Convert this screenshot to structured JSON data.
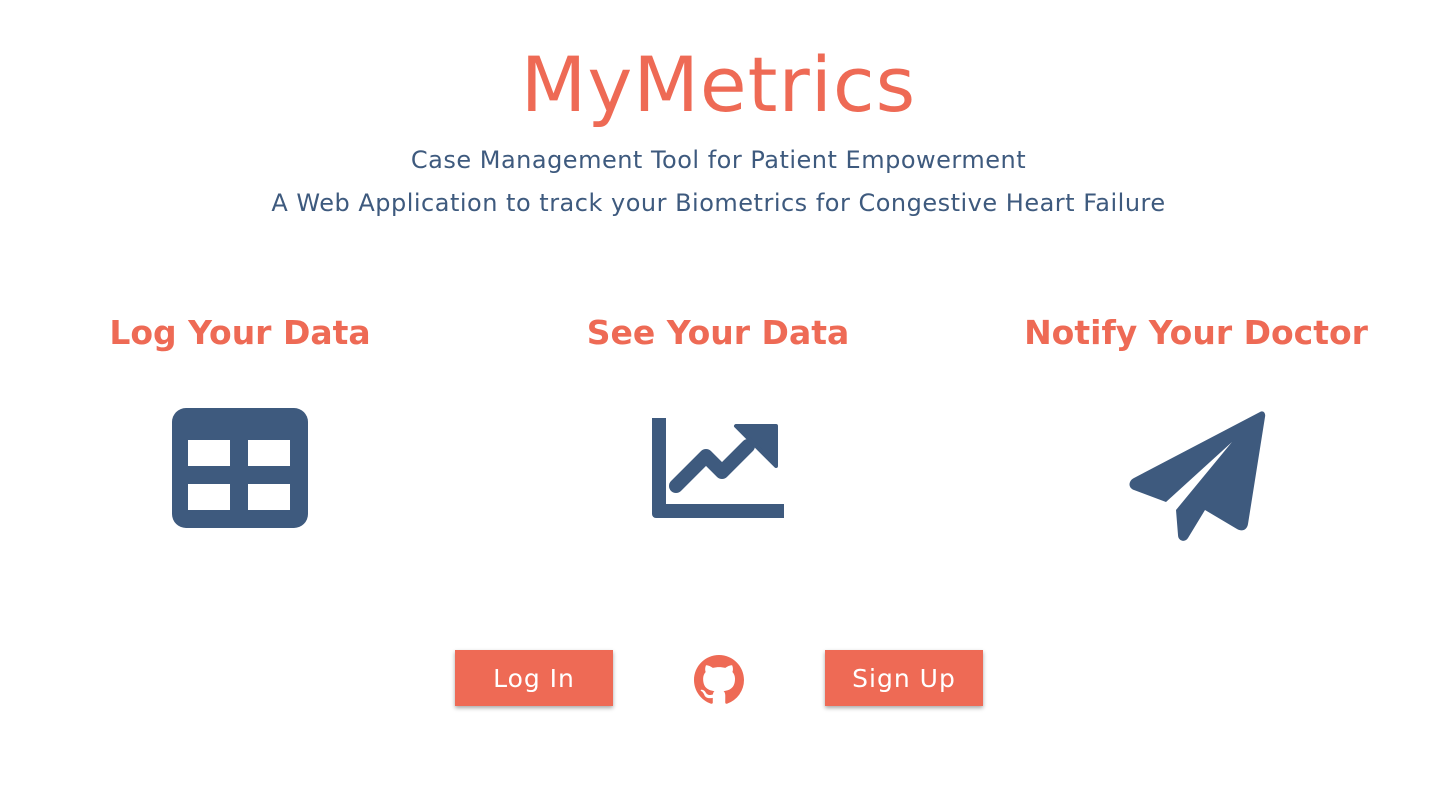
{
  "header": {
    "title": "MyMetrics",
    "subtitle_line1": "Case Management Tool for Patient Empowerment",
    "subtitle_line2": "A Web Application to track your Biometrics for Congestive Heart Failure"
  },
  "features": [
    {
      "title": "Log Your Data",
      "icon": "table-icon"
    },
    {
      "title": "See Your Data",
      "icon": "chart-line-icon"
    },
    {
      "title": "Notify Your Doctor",
      "icon": "paper-plane-icon"
    }
  ],
  "actions": {
    "login_label": "Log In",
    "signup_label": "Sign Up",
    "github_icon": "github-icon"
  },
  "colors": {
    "accent": "#ee6a55",
    "primary": "#3e5a7e",
    "background": "#ffffff"
  }
}
